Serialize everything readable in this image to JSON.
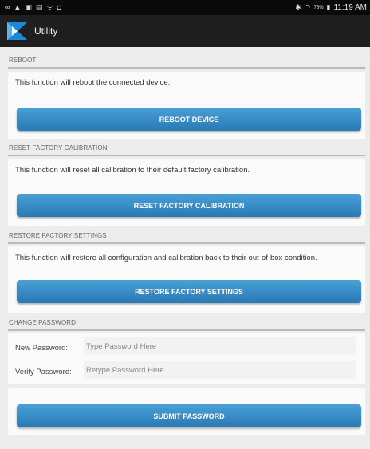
{
  "status_bar": {
    "left_icons": [
      "voicemail-icon",
      "warning-icon",
      "image-icon",
      "notes-icon",
      "signal-icon",
      "download-icon"
    ],
    "battery_percent": "75%",
    "time": "11:19 AM"
  },
  "app": {
    "title": "Utility",
    "brand_color": "#1e88d6"
  },
  "reboot": {
    "header": "REBOOT",
    "description": "This function will reboot the connected device.",
    "button": "REBOOT DEVICE"
  },
  "reset": {
    "header": "RESET FACTORY CALIBRATION",
    "description": "This function will reset all calibration to their default factory calibration.",
    "button": "RESET FACTORY CALIBRATION"
  },
  "restore": {
    "header": "RESTORE FACTORY SETTINGS",
    "description": "This function will restore all configuration and calibration back to their out-of-box condition.",
    "button": "RESTORE FACTORY SETTINGS"
  },
  "password": {
    "header": "CHANGE PASSWORD",
    "new_label": "New Password:",
    "new_placeholder": "Type Password Here",
    "verify_label": "Verify Password:",
    "verify_placeholder": "Retype Password Here",
    "button": "SUBMIT PASSWORD"
  },
  "colors": {
    "button_top": "#4aa0d7",
    "button_bottom": "#2979b4",
    "action_bar": "#1f1f1f",
    "status_bar": "#0a0a0a"
  }
}
